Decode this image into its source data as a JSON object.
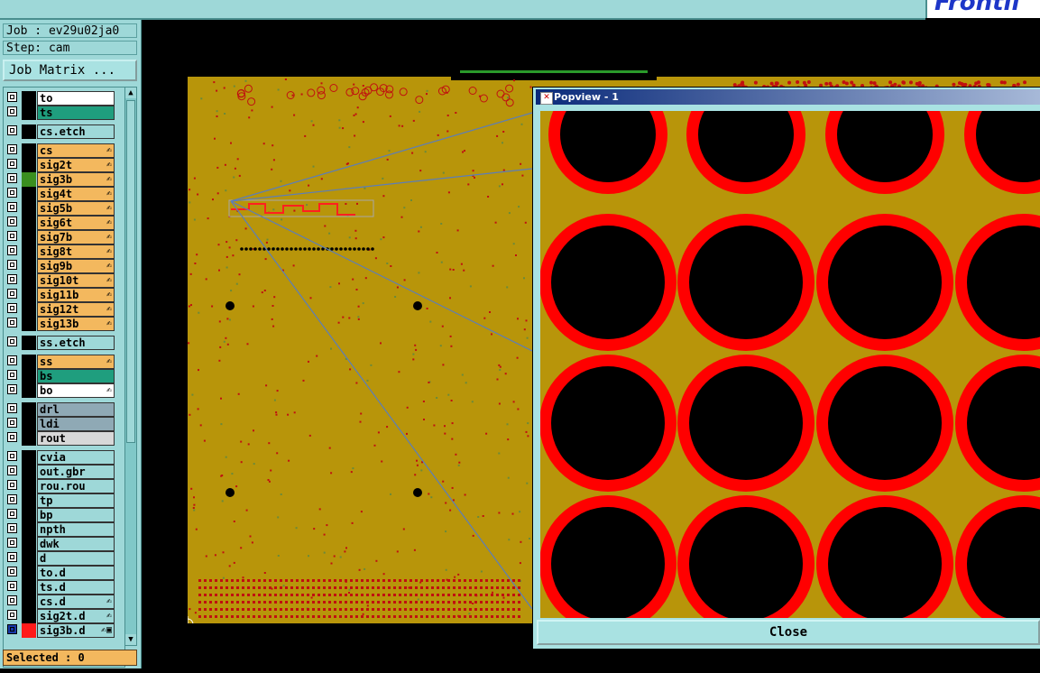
{
  "brand": "Frontli",
  "info": {
    "job": "Job : ev29u02ja0",
    "step": "Step: cam",
    "job_matrix_button": "Job Matrix ..."
  },
  "layers": [
    {
      "name": "to",
      "bg": "#ffffff",
      "swatch": "",
      "flag": ""
    },
    {
      "name": "ts",
      "bg": "#1f9e7e",
      "swatch": "",
      "flag": ""
    },
    {
      "name": "cs.etch",
      "bg": "#9ed8d8",
      "swatch": "",
      "flag": ""
    },
    {
      "name": "cs",
      "bg": "#f3b85e",
      "swatch": "",
      "flag": "✍"
    },
    {
      "name": "sig2t",
      "bg": "#f3b85e",
      "swatch": "",
      "flag": "✍"
    },
    {
      "name": "sig3b",
      "bg": "#f3b85e",
      "swatch": "#3a8f1f",
      "flag": "✍"
    },
    {
      "name": "sig4t",
      "bg": "#f3b85e",
      "swatch": "",
      "flag": "✍"
    },
    {
      "name": "sig5b",
      "bg": "#f3b85e",
      "swatch": "",
      "flag": "✍"
    },
    {
      "name": "sig6t",
      "bg": "#f3b85e",
      "swatch": "",
      "flag": "✍"
    },
    {
      "name": "sig7b",
      "bg": "#f3b85e",
      "swatch": "",
      "flag": "✍"
    },
    {
      "name": "sig8t",
      "bg": "#f3b85e",
      "swatch": "",
      "flag": "✍"
    },
    {
      "name": "sig9b",
      "bg": "#f3b85e",
      "swatch": "",
      "flag": "✍"
    },
    {
      "name": "sig10t",
      "bg": "#f3b85e",
      "swatch": "",
      "flag": "✍"
    },
    {
      "name": "sig11b",
      "bg": "#f3b85e",
      "swatch": "",
      "flag": "✍"
    },
    {
      "name": "sig12t",
      "bg": "#f3b85e",
      "swatch": "",
      "flag": "✍"
    },
    {
      "name": "sig13b",
      "bg": "#f3b85e",
      "swatch": "",
      "flag": "✍"
    },
    {
      "name": "ss.etch",
      "bg": "#9ed8d8",
      "swatch": "",
      "flag": ""
    },
    {
      "name": "ss",
      "bg": "#f3b85e",
      "swatch": "",
      "flag": "✍"
    },
    {
      "name": "bs",
      "bg": "#1f9e7e",
      "swatch": "",
      "flag": ""
    },
    {
      "name": "bo",
      "bg": "#ffffff",
      "swatch": "",
      "flag": "✍"
    },
    {
      "name": "drl",
      "bg": "#8fa9b5",
      "swatch": "",
      "flag": ""
    },
    {
      "name": "ldi",
      "bg": "#8fa9b5",
      "swatch": "",
      "flag": ""
    },
    {
      "name": "rout",
      "bg": "#d8d8d8",
      "swatch": "",
      "flag": ""
    },
    {
      "name": "cvia",
      "bg": "#9ed8d8",
      "swatch": "",
      "flag": ""
    },
    {
      "name": "out.gbr",
      "bg": "#9ed8d8",
      "swatch": "",
      "flag": ""
    },
    {
      "name": "rou.rou",
      "bg": "#9ed8d8",
      "swatch": "",
      "flag": ""
    },
    {
      "name": "tp",
      "bg": "#9ed8d8",
      "swatch": "",
      "flag": ""
    },
    {
      "name": "bp",
      "bg": "#9ed8d8",
      "swatch": "",
      "flag": ""
    },
    {
      "name": "npth",
      "bg": "#9ed8d8",
      "swatch": "",
      "flag": ""
    },
    {
      "name": "dwk",
      "bg": "#9ed8d8",
      "swatch": "",
      "flag": ""
    },
    {
      "name": "d",
      "bg": "#9ed8d8",
      "swatch": "",
      "flag": ""
    },
    {
      "name": "to.d",
      "bg": "#9ed8d8",
      "swatch": "",
      "flag": ""
    },
    {
      "name": "ts.d",
      "bg": "#9ed8d8",
      "swatch": "",
      "flag": ""
    },
    {
      "name": "cs.d",
      "bg": "#9ed8d8",
      "swatch": "",
      "flag": "✍"
    },
    {
      "name": "sig2t.d",
      "bg": "#9ed8d8",
      "swatch": "",
      "flag": "✍"
    },
    {
      "name": "sig3b.d",
      "bg": "#9ed8d8",
      "swatch": "#ff1a1a",
      "flag": "✍▣"
    }
  ],
  "selected": "Selected : 0",
  "popview": {
    "title": "Popview - 1",
    "close_label": "Close"
  },
  "colors": {
    "copper": "#b8950a",
    "pad": "#ff0000",
    "drill": "#000000",
    "panel": "#9ed8d8"
  }
}
